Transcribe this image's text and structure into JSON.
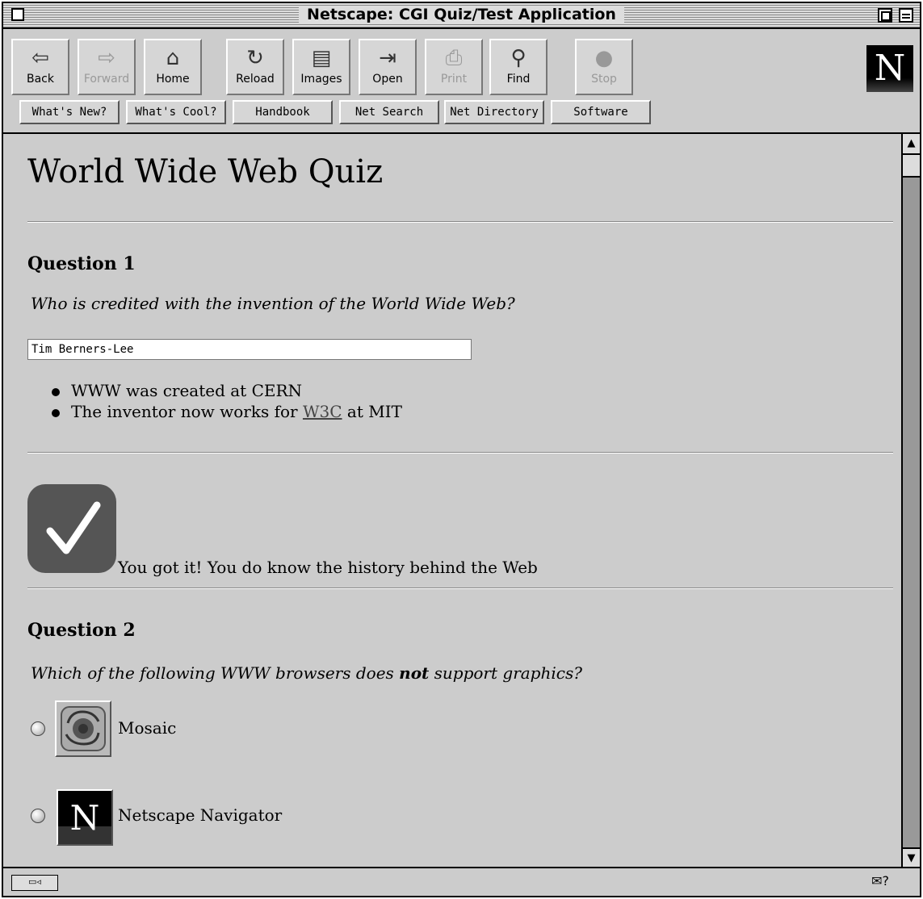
{
  "window": {
    "title": "Netscape: CGI Quiz/Test Application"
  },
  "toolbar": {
    "buttons": [
      {
        "label": "Back",
        "icon": "back-arrow-icon",
        "enabled": true
      },
      {
        "label": "Forward",
        "icon": "forward-arrow-icon",
        "enabled": false
      },
      {
        "label": "Home",
        "icon": "home-icon",
        "enabled": true
      },
      {
        "label": "Reload",
        "icon": "reload-icon",
        "enabled": true
      },
      {
        "label": "Images",
        "icon": "images-icon",
        "enabled": true
      },
      {
        "label": "Open",
        "icon": "open-icon",
        "enabled": true
      },
      {
        "label": "Print",
        "icon": "print-icon",
        "enabled": false
      },
      {
        "label": "Find",
        "icon": "find-icon",
        "enabled": true
      },
      {
        "label": "Stop",
        "icon": "stop-icon",
        "enabled": false
      }
    ],
    "directory_buttons": [
      {
        "label": "What's New?"
      },
      {
        "label": "What's Cool?"
      },
      {
        "label": "Handbook"
      },
      {
        "label": "Net Search"
      },
      {
        "label": "Net Directory"
      },
      {
        "label": "Software"
      }
    ],
    "logo": "N"
  },
  "page": {
    "title": "World Wide Web Quiz",
    "question1": {
      "heading": "Question 1",
      "text": "Who is credited with the invention of the World Wide Web?",
      "answer_value": "Tim Berners-Lee",
      "hints": [
        {
          "text": "WWW was created at CERN"
        },
        {
          "pre": "The inventor now works for ",
          "link": "W3C",
          "post": " at MIT"
        }
      ]
    },
    "feedback": {
      "icon": "checkmark-icon",
      "text": "You got it! You do know the history behind the Web"
    },
    "question2": {
      "heading": "Question 2",
      "text_pre": "Which of the following WWW browsers does ",
      "text_bold": "not",
      "text_post": " support graphics?",
      "options": [
        {
          "label": "Mosaic",
          "icon": "mosaic-logo-icon",
          "selected": false
        },
        {
          "label": "Netscape Navigator",
          "icon": "netscape-logo-icon",
          "selected": false
        }
      ]
    }
  },
  "colors": {
    "background": "#cccccc",
    "checkmark_tile": "#555555"
  }
}
